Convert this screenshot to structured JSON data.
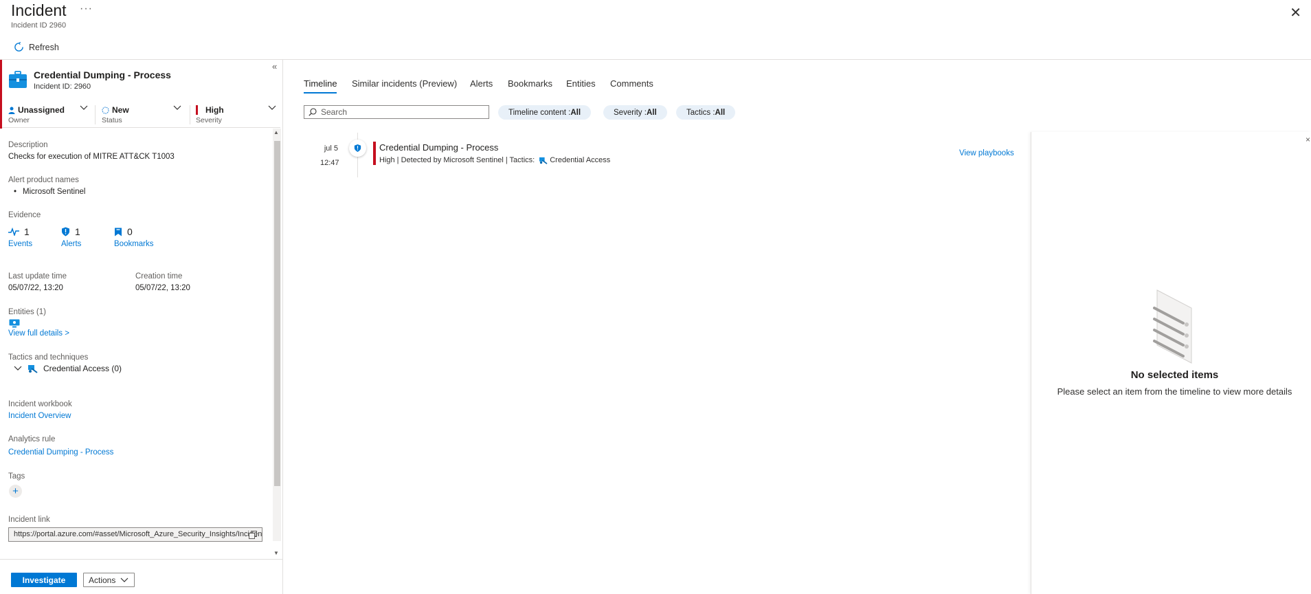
{
  "header": {
    "title": "Incident",
    "more": "···",
    "subtitle": "Incident ID 2960",
    "close": "✕",
    "refresh_label": "Refresh"
  },
  "incident": {
    "name": "Credential Dumping - Process",
    "id_label": "Incident ID: 2960",
    "owner": {
      "value": "Unassigned",
      "label": "Owner"
    },
    "status": {
      "value": "New",
      "label": "Status"
    },
    "severity": {
      "value": "High",
      "label": "Severity"
    },
    "description_label": "Description",
    "description": "Checks for execution of MITRE ATT&CK T1003",
    "alert_products_label": "Alert product names",
    "alert_products": [
      "Microsoft Sentinel"
    ],
    "evidence_label": "Evidence",
    "evidence": {
      "events": {
        "count": "1",
        "label": "Events"
      },
      "alerts": {
        "count": "1",
        "label": "Alerts"
      },
      "bookmarks": {
        "count": "0",
        "label": "Bookmarks"
      }
    },
    "last_update_label": "Last update time",
    "last_update": "05/07/22, 13:20",
    "creation_label": "Creation time",
    "creation": "05/07/22, 13:20",
    "entities_label": "Entities (1)",
    "view_full_details": "View full details >",
    "tactics_label": "Tactics and techniques",
    "tactic_item": "Credential Access (0)",
    "workbook_label": "Incident workbook",
    "workbook_link": "Incident Overview",
    "analytics_label": "Analytics rule",
    "analytics_link": "Credential Dumping - Process",
    "tags_label": "Tags",
    "tags_add": "+",
    "link_label": "Incident link",
    "link_value": "https://portal.azure.com/#asset/Microsoft_Azure_Security_Insights/Incident/subscriptions"
  },
  "footer": {
    "investigate": "Investigate",
    "actions": "Actions"
  },
  "tabs": [
    "Timeline",
    "Similar incidents (Preview)",
    "Alerts",
    "Bookmarks",
    "Entities",
    "Comments"
  ],
  "search": {
    "placeholder": "Search"
  },
  "filters": [
    {
      "label": "Timeline content : ",
      "value": "All"
    },
    {
      "label": "Severity : ",
      "value": "All"
    },
    {
      "label": "Tactics : ",
      "value": "All"
    }
  ],
  "timeline": {
    "date": "jul 5",
    "time": "12:47",
    "title": "Credential Dumping - Process",
    "meta_prefix": "High | Detected by Microsoft Sentinel | Tactics:",
    "meta_tactic": "Credential Access",
    "view_playbooks": "View playbooks"
  },
  "details": {
    "empty_title": "No selected items",
    "empty_sub": "Please select an item from the timeline to view more details",
    "close": "×"
  },
  "colors": {
    "accent": "#0078d4",
    "severity_high": "#c50f1f"
  }
}
